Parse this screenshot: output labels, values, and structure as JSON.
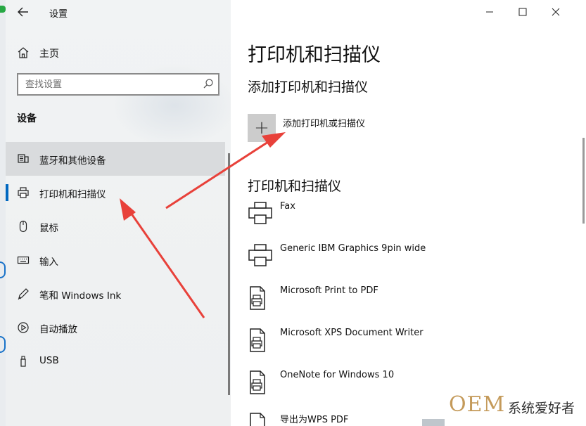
{
  "window": {
    "title": "设置"
  },
  "sidebar": {
    "home_label": "主页",
    "search_placeholder": "查找设置",
    "section_label": "设备",
    "items": [
      {
        "label": "蓝牙和其他设备",
        "icon": "bluetooth-devices-icon"
      },
      {
        "label": "打印机和扫描仪",
        "icon": "printer-icon"
      },
      {
        "label": "鼠标",
        "icon": "mouse-icon"
      },
      {
        "label": "输入",
        "icon": "keyboard-icon"
      },
      {
        "label": "笔和 Windows Ink",
        "icon": "pen-icon"
      },
      {
        "label": "自动播放",
        "icon": "autoplay-icon"
      },
      {
        "label": "USB",
        "icon": "usb-icon"
      }
    ]
  },
  "main": {
    "page_title": "打印机和扫描仪",
    "add_section_title": "添加打印机和扫描仪",
    "add_button_label": "添加打印机或扫描仪",
    "list_title": "打印机和扫描仪",
    "devices": [
      {
        "name": "Fax",
        "icon": "fax-printer-icon"
      },
      {
        "name": "Generic IBM Graphics 9pin wide",
        "icon": "printer-icon"
      },
      {
        "name": "Microsoft Print to PDF",
        "icon": "document-printer-icon"
      },
      {
        "name": "Microsoft XPS Document Writer",
        "icon": "document-printer-icon"
      },
      {
        "name": "OneNote for Windows 10",
        "icon": "document-printer-icon"
      },
      {
        "name": "导出为WPS PDF",
        "icon": "document-printer-icon"
      }
    ]
  },
  "watermark": {
    "brand": "OEM",
    "text": "系统爱好者"
  },
  "colors": {
    "accent": "#0067c0",
    "annotation_arrow": "#e8413a",
    "add_button_bg": "#cccccc"
  }
}
